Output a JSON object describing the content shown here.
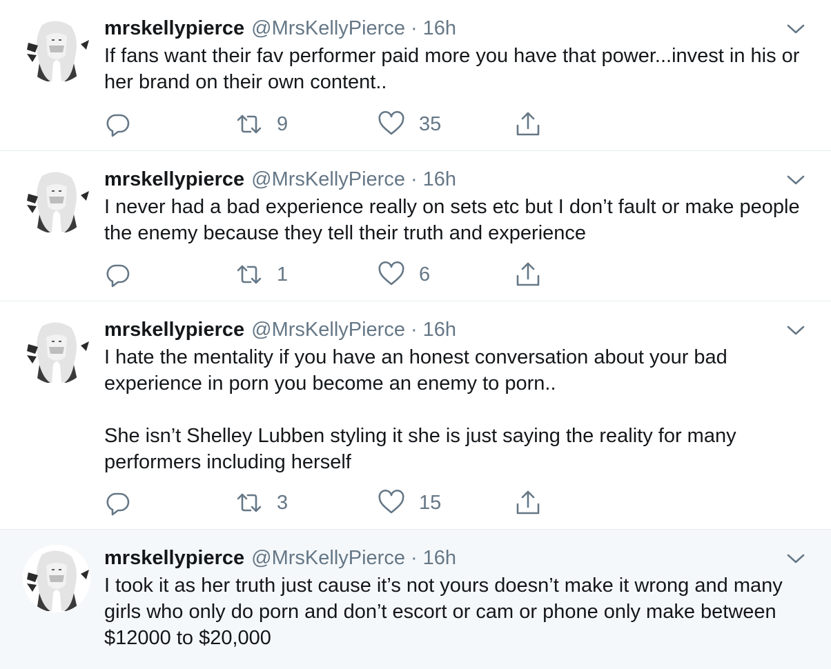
{
  "tweets": [
    {
      "name": "mrskellypierce",
      "handle": "@MrsKellyPierce",
      "separator": "·",
      "time": "16h",
      "paragraphs": [
        "If fans want their fav performer paid more you have that power...invest in his or her brand on their own content.."
      ],
      "retweets": "9",
      "likes": "35"
    },
    {
      "name": "mrskellypierce",
      "handle": "@MrsKellyPierce",
      "separator": "·",
      "time": "16h",
      "paragraphs": [
        "I never had a bad experience really on sets etc but I don’t fault or make people the enemy because they tell their truth and experience"
      ],
      "retweets": "1",
      "likes": "6"
    },
    {
      "name": "mrskellypierce",
      "handle": "@MrsKellyPierce",
      "separator": "·",
      "time": "16h",
      "paragraphs": [
        "I hate the mentality if you have an honest conversation about your bad experience in porn you become an enemy to porn..",
        "She isn’t  Shelley Lubben styling it she is just saying the reality for many performers including herself"
      ],
      "retweets": "3",
      "likes": "15"
    },
    {
      "name": "mrskellypierce",
      "handle": "@MrsKellyPierce",
      "separator": "·",
      "time": "16h",
      "paragraphs": [
        "I took it as her truth just cause it’s not yours doesn’t make it wrong and many girls who only do porn and don’t escort or cam or phone only make between $12000 to $20,000"
      ]
    }
  ],
  "icons": {
    "reply": "reply-icon",
    "retweet": "retweet-icon",
    "like": "heart-icon",
    "share": "share-icon",
    "more": "chevron-down-icon"
  },
  "colors": {
    "text": "#14171a",
    "secondary": "#657786",
    "divider": "#e6ecf0",
    "highlight_bg": "#f5f8fa"
  }
}
